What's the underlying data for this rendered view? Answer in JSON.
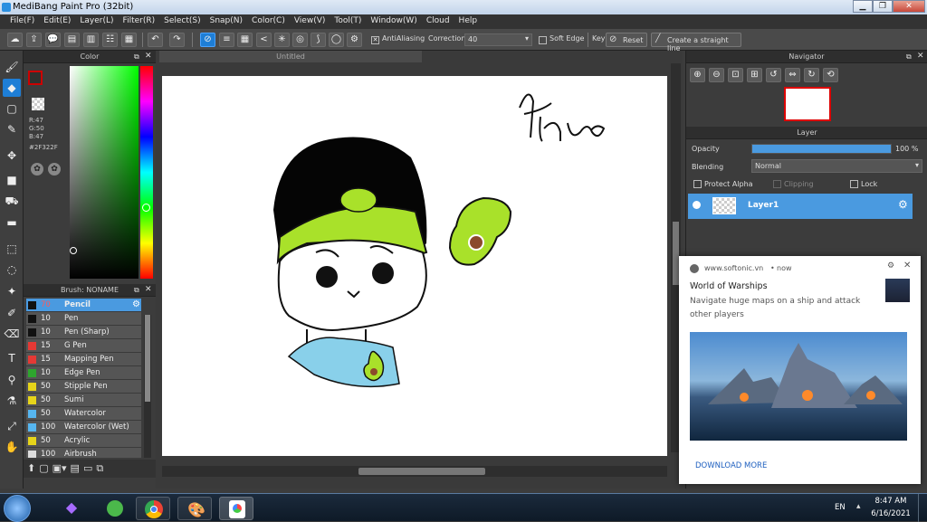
{
  "window": {
    "title": "MediBang Paint Pro (32bit)"
  },
  "menu": [
    "File(F)",
    "Edit(E)",
    "Layer(L)",
    "Filter(R)",
    "Select(S)",
    "Snap(N)",
    "Color(C)",
    "View(V)",
    "Tool(T)",
    "Window(W)",
    "Cloud",
    "Help"
  ],
  "toolbar": {
    "antialiasing": "AntiAliasing",
    "correction_label": "Correction",
    "correction_value": "40",
    "soft_edge": "Soft Edge",
    "key": "Key",
    "reset": "Reset",
    "straight_line": "Create a straight line"
  },
  "color_panel": {
    "title": "Color",
    "r": "R:47",
    "g": "G:50",
    "b": "B:47",
    "hex": "#2F322F",
    "fg": "#2f322f"
  },
  "brush_panel": {
    "title": "Brush: NONAME",
    "brushes": [
      {
        "size": "70",
        "name": "Pencil",
        "color": "#111111"
      },
      {
        "size": "10",
        "name": "Pen",
        "color": "#111111"
      },
      {
        "size": "10",
        "name": "Pen (Sharp)",
        "color": "#111111"
      },
      {
        "size": "15",
        "name": "G Pen",
        "color": "#e53935"
      },
      {
        "size": "15",
        "name": "Mapping Pen",
        "color": "#e53935"
      },
      {
        "size": "10",
        "name": "Edge Pen",
        "color": "#2ea52e"
      },
      {
        "size": "50",
        "name": "Stipple Pen",
        "color": "#e6d41a"
      },
      {
        "size": "50",
        "name": "Sumi",
        "color": "#e6d41a"
      },
      {
        "size": "50",
        "name": "Watercolor",
        "color": "#56b6f0"
      },
      {
        "size": "100",
        "name": "Watercolor (Wet)",
        "color": "#56b6f0"
      },
      {
        "size": "50",
        "name": "Acrylic",
        "color": "#e6d41a"
      },
      {
        "size": "100",
        "name": "Airbrush",
        "color": "#dddddd"
      }
    ]
  },
  "document": {
    "tab": "Untitled",
    "signature": "Thảo"
  },
  "navigator": {
    "title": "Navigator"
  },
  "layer_panel": {
    "title": "Layer",
    "opacity_label": "Opacity",
    "opacity_value": "100 %",
    "opacity": 1.0,
    "blending_label": "Blending",
    "blending_value": "Normal",
    "protect_alpha": "Protect Alpha",
    "clipping": "Clipping",
    "lock": "Lock",
    "layer_name": "Layer1"
  },
  "notification": {
    "source": "www.softonic.vn",
    "time": "now",
    "title": "World of Warships",
    "body": "Navigate huge maps on a ship and attack other players",
    "action": "DOWNLOAD MORE"
  },
  "taskbar": {
    "lang": "EN",
    "time": "8:47 AM",
    "date": "6/16/2021"
  }
}
